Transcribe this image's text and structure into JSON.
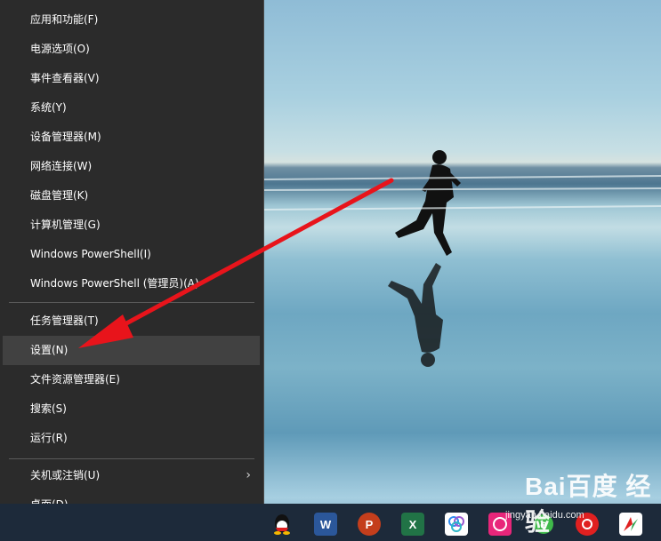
{
  "menu": {
    "items": [
      {
        "label": "应用和功能(F)"
      },
      {
        "label": "电源选项(O)"
      },
      {
        "label": "事件查看器(V)"
      },
      {
        "label": "系统(Y)"
      },
      {
        "label": "设备管理器(M)"
      },
      {
        "label": "网络连接(W)"
      },
      {
        "label": "磁盘管理(K)"
      },
      {
        "label": "计算机管理(G)"
      },
      {
        "label": "Windows PowerShell(I)"
      },
      {
        "label": "Windows PowerShell (管理员)(A)"
      },
      {
        "label": "任务管理器(T)"
      },
      {
        "label": "设置(N)",
        "highlighted": true
      },
      {
        "label": "文件资源管理器(E)"
      },
      {
        "label": "搜索(S)"
      },
      {
        "label": "运行(R)"
      },
      {
        "label": "关机或注销(U)",
        "has_submenu": true
      },
      {
        "label": "桌面(D)"
      }
    ],
    "highlight_color": "#414141",
    "background_color": "#2b2b2b"
  },
  "taskbar": {
    "icons": [
      {
        "name": "qq-icon"
      },
      {
        "name": "word-icon",
        "glyph": "W",
        "color": "#2b579a"
      },
      {
        "name": "powerpoint-icon",
        "glyph": "P",
        "color": "#c43e1c"
      },
      {
        "name": "excel-icon",
        "glyph": "X",
        "color": "#217346"
      },
      {
        "name": "app-icon-blue"
      },
      {
        "name": "app-icon-pink"
      },
      {
        "name": "browser-icon-green"
      },
      {
        "name": "netease-music-icon"
      },
      {
        "name": "app-icon-red-green"
      }
    ]
  },
  "annotation": {
    "arrow_color": "#e8141b"
  },
  "watermark": {
    "logo": "Bai百度 经验",
    "url": "jingyan.baidu.com"
  }
}
